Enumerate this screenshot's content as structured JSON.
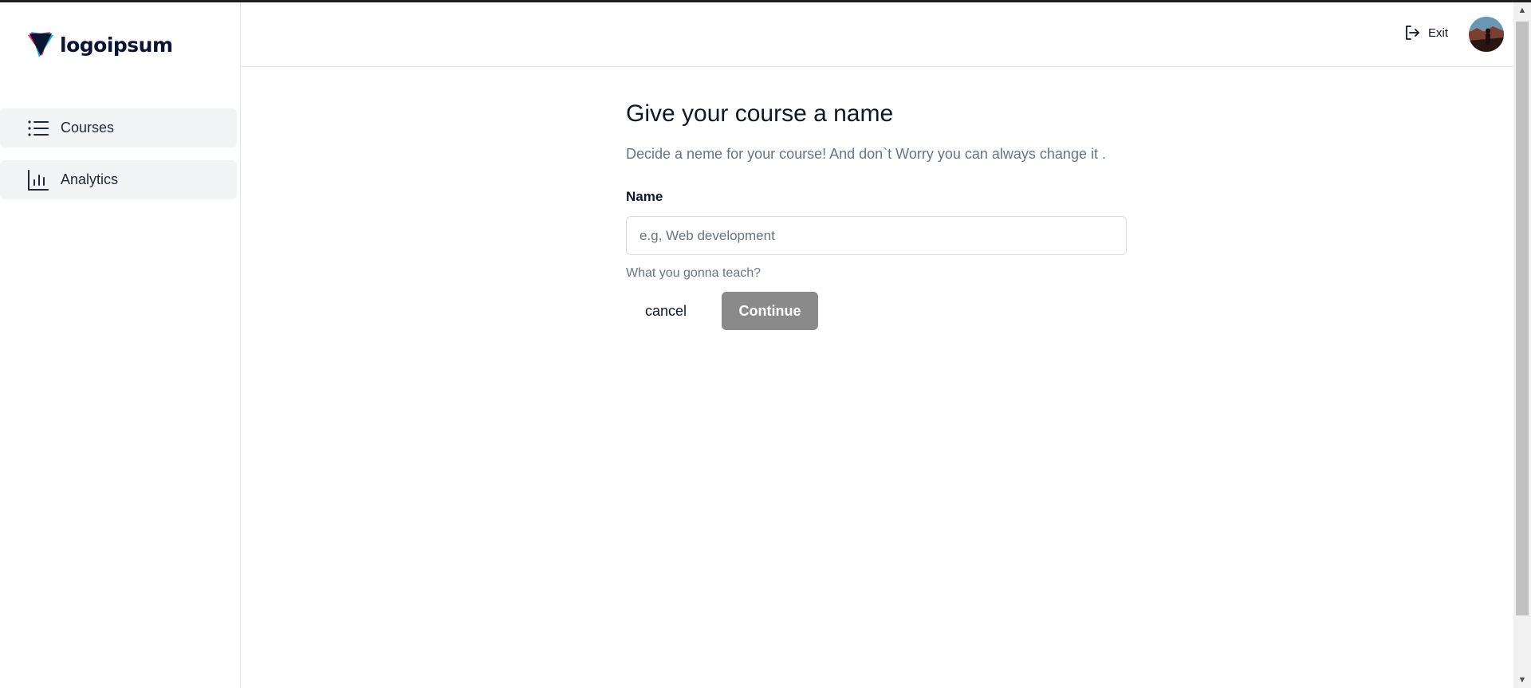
{
  "brand": {
    "name": "logoipsum",
    "colors": {
      "dark": "#0b1532",
      "pink": "#e53170",
      "cyan": "#1ab3e6"
    }
  },
  "sidebar": {
    "items": [
      {
        "label": "Courses",
        "icon": "list-icon"
      },
      {
        "label": "Analytics",
        "icon": "bar-chart-icon"
      }
    ]
  },
  "header": {
    "exit_label": "Exit",
    "exit_icon": "log-out-icon",
    "avatar_icon": "user-avatar"
  },
  "form": {
    "title": "Give your course a name",
    "subtitle": "Decide a neme for your course! And don`t Worry you can always change it .",
    "name_label": "Name",
    "name_placeholder": "e.g, Web development",
    "name_value": "",
    "helper": "What you gonna teach?",
    "cancel_label": "cancel",
    "continue_label": "Continue",
    "continue_color": "#8a8a8a"
  },
  "scrollbar": {
    "up_icon": "chevron-up-icon",
    "down_icon": "chevron-down-icon"
  }
}
